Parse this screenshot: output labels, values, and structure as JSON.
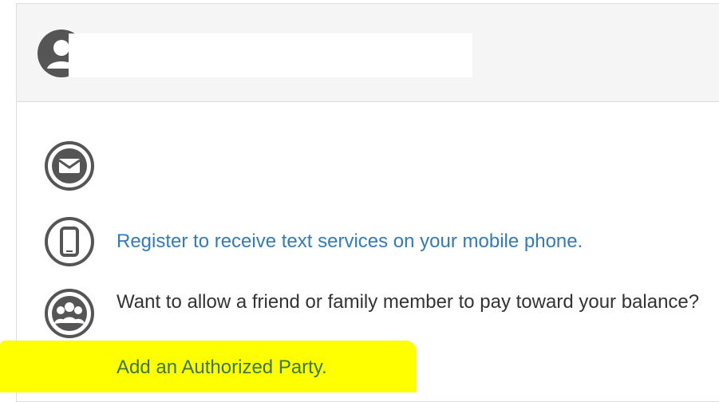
{
  "contact": {
    "mobile_link": "Register to receive text services on your mobile phone.",
    "authorized_party_prompt": "Want to allow a friend or family member to pay toward your balance?",
    "authorized_party_link": "Add an Authorized Party."
  },
  "icons": {
    "avatar": "user-avatar-icon",
    "email": "envelope-icon",
    "mobile": "mobile-phone-icon",
    "group": "group-users-icon"
  },
  "colors": {
    "link": "#337ab7",
    "icon": "#555555",
    "highlight": "#ffff00",
    "authorized_link": "#3c763d"
  }
}
